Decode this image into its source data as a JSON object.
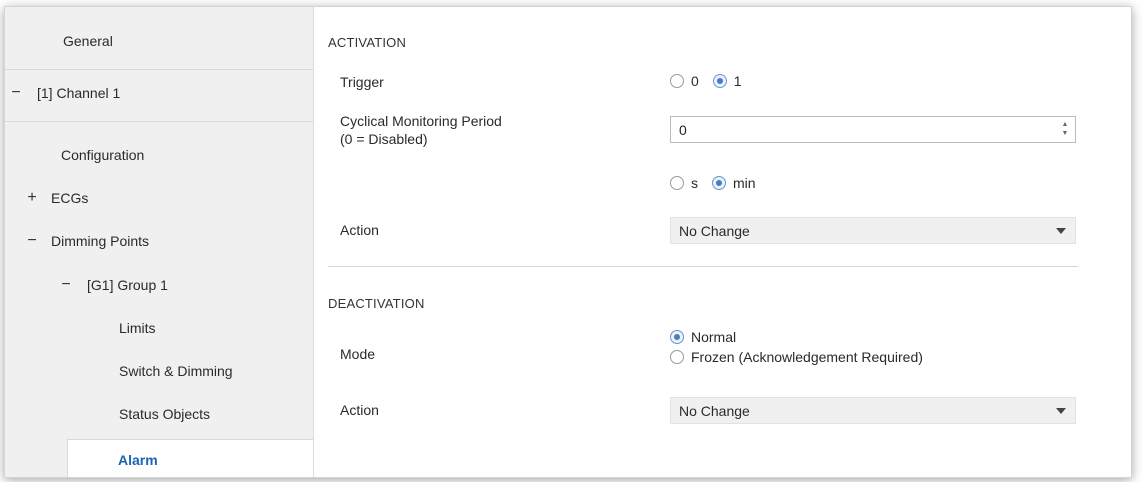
{
  "sidebar": {
    "items": [
      {
        "label": "General",
        "symbol": ""
      },
      {
        "label": "[1] Channel 1",
        "symbol": "−"
      },
      {
        "label": "Configuration",
        "symbol": ""
      },
      {
        "label": "ECGs",
        "symbol": "+"
      },
      {
        "label": "Dimming Points",
        "symbol": "−"
      },
      {
        "label": "[G1] Group 1",
        "symbol": "−"
      },
      {
        "label": "Limits",
        "symbol": ""
      },
      {
        "label": "Switch & Dimming",
        "symbol": ""
      },
      {
        "label": "Status Objects",
        "symbol": ""
      },
      {
        "label": "Alarm",
        "symbol": ""
      }
    ]
  },
  "activation": {
    "title": "ACTIVATION",
    "trigger": {
      "label": "Trigger",
      "options": [
        "0",
        "1"
      ],
      "selected": "1"
    },
    "cyclical": {
      "label_line1": "Cyclical Monitoring Period",
      "label_line2": "(0 = Disabled)",
      "value": "0"
    },
    "unit": {
      "options": [
        "s",
        "min"
      ],
      "selected": "min"
    },
    "action": {
      "label": "Action",
      "value": "No Change"
    }
  },
  "deactivation": {
    "title": "DEACTIVATION",
    "mode": {
      "label": "Mode",
      "options": [
        "Normal",
        "Frozen (Acknowledgement Required)"
      ],
      "selected": "Normal"
    },
    "action": {
      "label": "Action",
      "value": "No Change"
    }
  },
  "colors": {
    "active_nav": "#1b64b4",
    "radio_selected": "#4a7cc0",
    "sidebar_bg": "#f0f0f0"
  }
}
